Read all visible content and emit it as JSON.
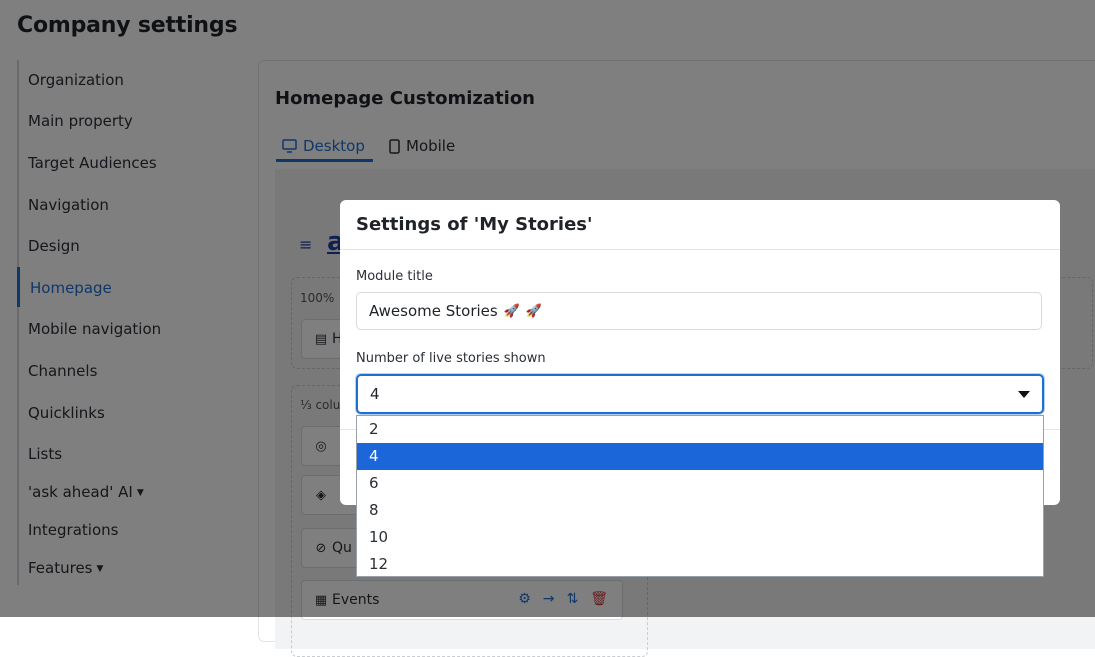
{
  "page": {
    "title": "Company settings"
  },
  "sidebar": {
    "items": [
      {
        "label": "Organization"
      },
      {
        "label": "Main property"
      },
      {
        "label": "Target Audiences"
      },
      {
        "label": "Navigation"
      },
      {
        "label": "Design"
      },
      {
        "label": "Homepage"
      },
      {
        "label": "Mobile navigation"
      },
      {
        "label": "Channels"
      },
      {
        "label": "Quicklinks"
      },
      {
        "label": "Lists"
      },
      {
        "label": "'ask ahead' AI"
      },
      {
        "label": "Integrations"
      },
      {
        "label": "Features"
      }
    ],
    "active": "Homepage"
  },
  "homepage": {
    "title": "Homepage Customization",
    "tabs": [
      {
        "label": "Desktop"
      },
      {
        "label": "Mobile"
      }
    ],
    "logo_fragment": "a",
    "width_label": "100%",
    "column_label": "⅓ colu",
    "modules": [
      {
        "label": "H",
        "icon": "newspaper-icon"
      },
      {
        "label": "",
        "icon": "compass-icon"
      },
      {
        "label": "",
        "icon": "graduation-cap-icon"
      },
      {
        "label": "Qu",
        "icon": "link-icon"
      },
      {
        "label": "Events",
        "icon": "calendar-icon"
      }
    ]
  },
  "modal": {
    "title": "Settings of 'My Stories'",
    "module_title_label": "Module title",
    "module_title_value": "Awesome Stories",
    "stories_label": "Number of live stories shown",
    "stories_value": "4",
    "options": [
      "2",
      "4",
      "6",
      "8",
      "10",
      "12"
    ]
  },
  "colors": {
    "accent": "#1f6fd1",
    "selected_option": "#1b66d8",
    "delete": "#d23a3a"
  }
}
